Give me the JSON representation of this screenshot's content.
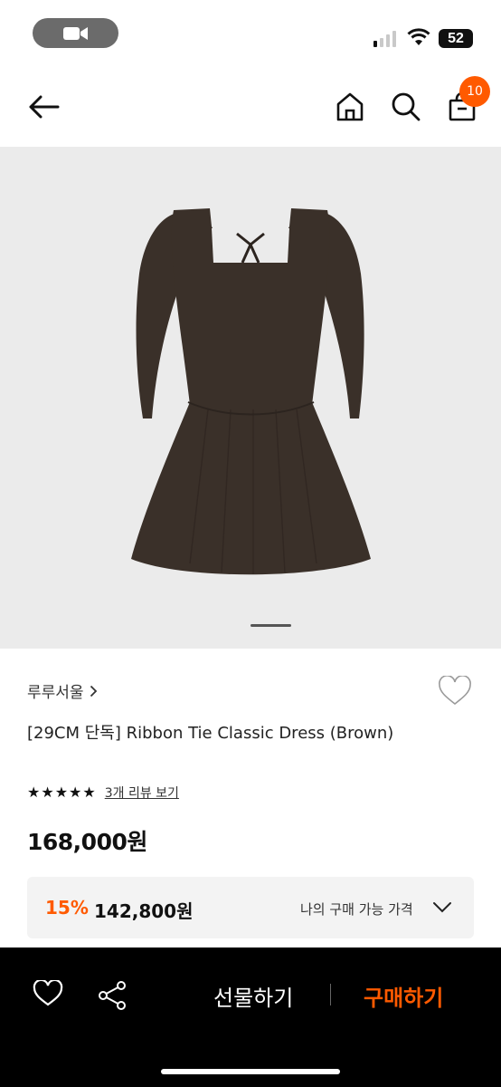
{
  "status": {
    "battery": "52",
    "icons": [
      "video-camera-icon",
      "cellular-signal-icon",
      "wifi-icon",
      "battery-icon"
    ]
  },
  "header": {
    "cart_count": "10",
    "icons": [
      "back-arrow-icon",
      "home-icon",
      "search-icon",
      "shopping-bag-icon"
    ]
  },
  "product": {
    "brand": "루루서울",
    "name": "[29CM 단독] Ribbon Tie Classic Dress (Brown)",
    "rating_stars": 5,
    "review_link": "3개 리뷰 보기",
    "price": "168,000원",
    "discount": {
      "rate": "15%",
      "price": "142,800원",
      "label": "나의 구매 가능 가격"
    }
  },
  "bottom": {
    "gift_label": "선물하기",
    "buy_label": "구매하기",
    "icons": [
      "heart-icon",
      "share-icon"
    ]
  },
  "colors": {
    "accent": "#ff5a00",
    "dress": "#3a3029",
    "gallery_bg": "#ebebeb"
  }
}
